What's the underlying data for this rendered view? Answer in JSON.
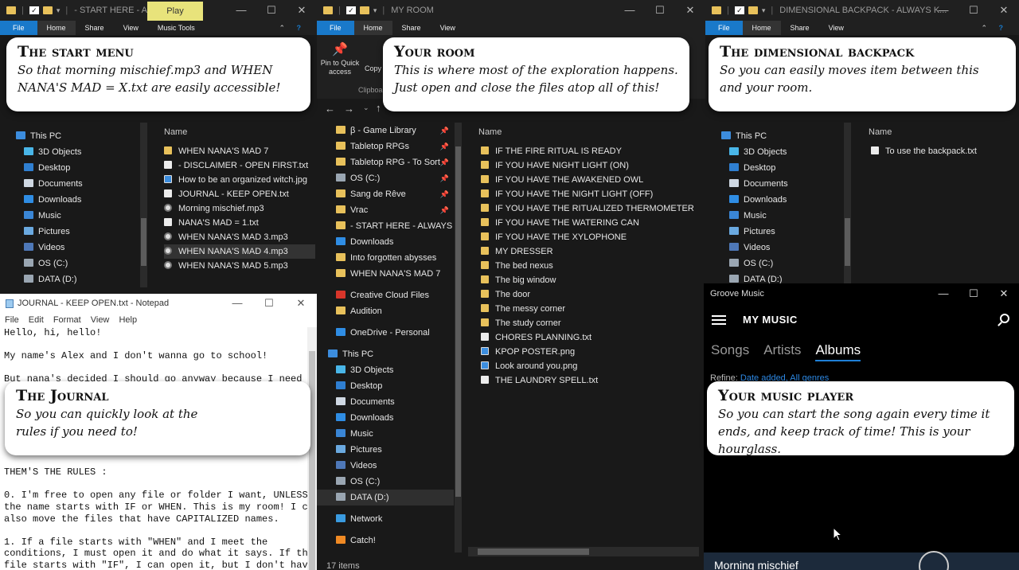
{
  "win1": {
    "title": "- START HERE - AL...",
    "play_tab": "Play",
    "ribbon": [
      "File",
      "Home",
      "Share",
      "View",
      "Music Tools"
    ],
    "nav": [
      {
        "label": "This PC",
        "icon": "pc-icon"
      },
      {
        "label": "3D Objects",
        "icon": "3d-objects-icon"
      },
      {
        "label": "Desktop",
        "icon": "desktop-icon"
      },
      {
        "label": "Documents",
        "icon": "documents-icon"
      },
      {
        "label": "Downloads",
        "icon": "downloads-icon"
      },
      {
        "label": "Music",
        "icon": "music-icon"
      },
      {
        "label": "Pictures",
        "icon": "pictures-icon"
      },
      {
        "label": "Videos",
        "icon": "videos-icon"
      },
      {
        "label": "OS (C:)",
        "icon": "drive-icon"
      },
      {
        "label": "DATA (D:)",
        "icon": "drive-icon"
      }
    ],
    "column": "Name",
    "files": [
      {
        "name": "WHEN NANA'S MAD 7",
        "type": "folder"
      },
      {
        "name": "- DISCLAIMER - OPEN FIRST.txt",
        "type": "txt"
      },
      {
        "name": "How to be an organized witch.jpg",
        "type": "img"
      },
      {
        "name": "JOURNAL - KEEP OPEN.txt",
        "type": "txt"
      },
      {
        "name": "Morning mischief.mp3",
        "type": "mp3"
      },
      {
        "name": "NANA'S MAD = 1.txt",
        "type": "txt"
      },
      {
        "name": "WHEN NANA'S MAD 3.mp3",
        "type": "mp3"
      },
      {
        "name": "WHEN NANA'S MAD 4.mp3",
        "type": "mp3",
        "selected": true
      },
      {
        "name": "WHEN NANA'S MAD 5.mp3",
        "type": "mp3"
      }
    ]
  },
  "win2": {
    "title": "MY ROOM",
    "ribbon": [
      "File",
      "Home",
      "Share",
      "View"
    ],
    "pin_label": "Pin to Quick",
    "pin_label2": "access",
    "copy_label": "Copy",
    "clipboard_label": "Clipboa",
    "nav": [
      {
        "label": "β - Game Library",
        "icon": "folder-icon",
        "pinned": true
      },
      {
        "label": "Tabletop RPGs",
        "icon": "folder-icon",
        "pinned": true
      },
      {
        "label": "Tabletop RPG - To Sort",
        "icon": "folder-icon",
        "pinned": true
      },
      {
        "label": "OS (C:)",
        "icon": "drive-icon",
        "pinned": true
      },
      {
        "label": "Sang de Rêve",
        "icon": "folder-icon",
        "pinned": true
      },
      {
        "label": "Vrac",
        "icon": "folder-icon",
        "pinned": true
      },
      {
        "label": "- START HERE - ALWAYS KEEP",
        "icon": "folder-icon"
      },
      {
        "label": "Downloads",
        "icon": "downloads-icon"
      },
      {
        "label": "Into forgotten abysses",
        "icon": "folder-icon"
      },
      {
        "label": "WHEN NANA'S MAD 7",
        "icon": "folder-icon"
      },
      {
        "label": "",
        "icon": ""
      },
      {
        "label": "Creative Cloud Files",
        "icon": "creative-cloud-icon"
      },
      {
        "label": "Audition",
        "icon": "folder-icon"
      },
      {
        "label": "",
        "icon": ""
      },
      {
        "label": "OneDrive - Personal",
        "icon": "onedrive-icon"
      },
      {
        "label": "",
        "icon": ""
      },
      {
        "label": "This PC",
        "icon": "pc-icon"
      },
      {
        "label": "3D Objects",
        "icon": "3d-objects-icon"
      },
      {
        "label": "Desktop",
        "icon": "desktop-icon"
      },
      {
        "label": "Documents",
        "icon": "documents-icon"
      },
      {
        "label": "Downloads",
        "icon": "downloads-icon"
      },
      {
        "label": "Music",
        "icon": "music-icon"
      },
      {
        "label": "Pictures",
        "icon": "pictures-icon"
      },
      {
        "label": "Videos",
        "icon": "videos-icon"
      },
      {
        "label": "OS (C:)",
        "icon": "drive-icon"
      },
      {
        "label": "DATA (D:)",
        "icon": "drive-icon",
        "selected": true
      },
      {
        "label": "",
        "icon": ""
      },
      {
        "label": "Network",
        "icon": "network-icon"
      },
      {
        "label": "",
        "icon": ""
      },
      {
        "label": "Catch!",
        "icon": "catch-icon"
      }
    ],
    "column": "Name",
    "files": [
      {
        "name": "IF THE FIRE RITUAL IS READY",
        "type": "folder"
      },
      {
        "name": "IF YOU HAVE NIGHT LIGHT (ON)",
        "type": "folder"
      },
      {
        "name": "IF YOU HAVE THE AWAKENED OWL",
        "type": "folder"
      },
      {
        "name": "IF YOU HAVE THE NIGHT LIGHT (OFF)",
        "type": "folder"
      },
      {
        "name": "IF YOU HAVE THE RITUALIZED THERMOMETER",
        "type": "folder"
      },
      {
        "name": "IF YOU HAVE THE WATERING CAN",
        "type": "folder"
      },
      {
        "name": "IF YOU HAVE THE XYLOPHONE",
        "type": "folder"
      },
      {
        "name": "MY DRESSER",
        "type": "folder"
      },
      {
        "name": "The bed nexus",
        "type": "folder"
      },
      {
        "name": "The big window",
        "type": "folder"
      },
      {
        "name": "The door",
        "type": "folder"
      },
      {
        "name": "The messy corner",
        "type": "folder"
      },
      {
        "name": "The study corner",
        "type": "folder"
      },
      {
        "name": "CHORES PLANNING.txt",
        "type": "txt"
      },
      {
        "name": "KPOP POSTER.png",
        "type": "img"
      },
      {
        "name": "Look around you.png",
        "type": "img"
      },
      {
        "name": "THE LAUNDRY SPELL.txt",
        "type": "txt"
      }
    ],
    "status": "17 items"
  },
  "win3": {
    "title": "DIMENSIONAL BACKPACK - ALWAYS K...",
    "ribbon": [
      "File",
      "Home",
      "Share",
      "View"
    ],
    "nav": [
      {
        "label": "This PC",
        "icon": "pc-icon"
      },
      {
        "label": "3D Objects",
        "icon": "3d-objects-icon"
      },
      {
        "label": "Desktop",
        "icon": "desktop-icon"
      },
      {
        "label": "Documents",
        "icon": "documents-icon"
      },
      {
        "label": "Downloads",
        "icon": "downloads-icon"
      },
      {
        "label": "Music",
        "icon": "music-icon"
      },
      {
        "label": "Pictures",
        "icon": "pictures-icon"
      },
      {
        "label": "Videos",
        "icon": "videos-icon"
      },
      {
        "label": "OS (C:)",
        "icon": "drive-icon"
      },
      {
        "label": "DATA (D:)",
        "icon": "drive-icon"
      }
    ],
    "column": "Name",
    "files": [
      {
        "name": "To use the backpack.txt",
        "type": "txt"
      }
    ]
  },
  "notepad": {
    "title": "JOURNAL - KEEP OPEN.txt - Notepad",
    "menu": [
      "File",
      "Edit",
      "Format",
      "View",
      "Help"
    ],
    "lines": [
      "Hello, hi, hello!",
      "",
      "My name's Alex and I don't wanna go to school!",
      "",
      "But nana's decided I should go anyway because I need an",
      "",
      "",
      "",
      "",
      "",
      "",
      "",
      "THEM'S THE RULES :",
      "",
      "0. I'm free to open any file or folder I want, UNLESS",
      "the name starts with IF or WHEN. This is my room! I can",
      "also move the files that have CAPITALIZED names.",
      "",
      "1. If a file starts with \"WHEN\" and I meet the",
      "conditions, I must open it and do what it says. If the",
      "file starts with \"IF\", I can open it, but I don't have"
    ]
  },
  "groove": {
    "title": "Groove Music",
    "heading": "MY MUSIC",
    "tabs": [
      "Songs",
      "Artists",
      "Albums"
    ],
    "active_tab": "Albums",
    "refine_label": "Refine:",
    "refine_value": "Date added, All genres",
    "now_playing": "Morning mischief"
  },
  "callouts": {
    "start": {
      "title": "The start menu",
      "body": "So that morning mischief.mp3 and WHEN NANA'S MAD = X.txt are easily accessible!"
    },
    "room": {
      "title": "Your room",
      "body": "This is where most of the exploration happens. Just open and close the files atop all of this!"
    },
    "backpack": {
      "title": "The dimensional backpack",
      "body": "So you can easily moves item between this and your room."
    },
    "journal": {
      "title": "The Journal",
      "body": "So you can quickly look at the rules if you need to!"
    },
    "music": {
      "title": "Your music player",
      "body": "So you can start the song again every time it ends, and keep track of time! This is your hourglass."
    }
  },
  "colors": {
    "accent": "#1979ca",
    "folder": "#e8c15b",
    "play_tab": "#e8e37b"
  }
}
